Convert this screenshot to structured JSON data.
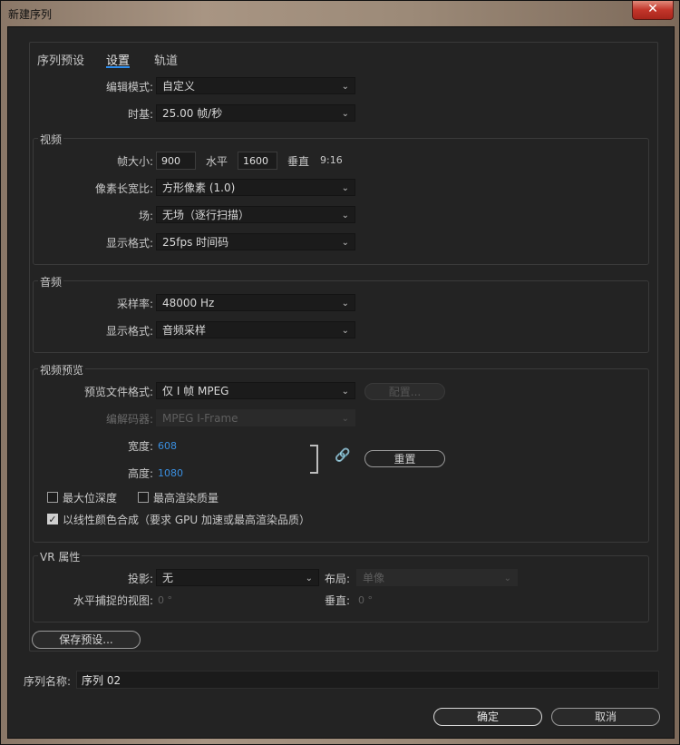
{
  "window": {
    "title": "新建序列",
    "close_symbol": "✕"
  },
  "tabs": [
    {
      "label": "序列预设",
      "active": false
    },
    {
      "label": "设置",
      "active": true
    },
    {
      "label": "轨道",
      "active": false
    }
  ],
  "editing": {
    "mode_label": "编辑模式:",
    "mode_value": "自定义",
    "timebase_label": "时基:",
    "timebase_value": "25.00  帧/秒"
  },
  "video": {
    "group_label": "视频",
    "frame_size_label": "帧大小:",
    "width_value": "900",
    "horizontal_label": "水平",
    "height_value": "1600",
    "vertical_label": "垂直",
    "ratio": "9:16",
    "pixel_aspect_label": "像素长宽比:",
    "pixel_aspect_value": "方形像素 (1.0)",
    "field_label": "场:",
    "field_value": "无场（逐行扫描）",
    "display_format_label": "显示格式:",
    "display_format_value": "25fps 时间码"
  },
  "audio": {
    "group_label": "音频",
    "sample_rate_label": "采样率:",
    "sample_rate_value": "48000 Hz",
    "display_format_label": "显示格式:",
    "display_format_value": "音频采样"
  },
  "preview": {
    "group_label": "视频预览",
    "file_format_label": "预览文件格式:",
    "file_format_value": "仅 I 帧 MPEG",
    "configure_label": "配置...",
    "codec_label": "编解码器:",
    "codec_value": "MPEG I-Frame",
    "width_label": "宽度:",
    "width_value": "608",
    "height_label": "高度:",
    "height_value": "1080",
    "reset_label": "重置",
    "max_bit_depth_label": "最大位深度",
    "max_bit_depth_checked": false,
    "max_render_label": "最高渲染质量",
    "max_render_checked": false,
    "linear_color_label": "以线性颜色合成（要求 GPU 加速或最高渲染品质）",
    "linear_color_checked": true,
    "check_mark": "✓"
  },
  "vr": {
    "group_label": "VR 属性",
    "projection_label": "投影:",
    "projection_value": "无",
    "layout_label": "布局:",
    "layout_value": "单像",
    "h_fov_label": "水平捕捉的视图:",
    "h_fov_value": "0 °",
    "v_label": "垂直:",
    "v_value": "0 °"
  },
  "save_preset_label": "保存预设...",
  "sequence_name_label": "序列名称:",
  "sequence_name_value": "序列 02",
  "ok_label": "确定",
  "cancel_label": "取消",
  "arrow_glyph": "⌄"
}
